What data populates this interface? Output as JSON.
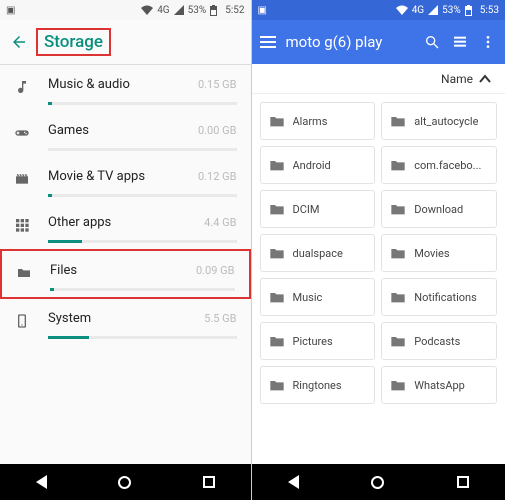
{
  "left": {
    "statusbar": {
      "lte": "4G",
      "signal": "▲",
      "battery": "53%",
      "time": "5:52"
    },
    "title": "Storage",
    "items": [
      {
        "label": "Music & audio",
        "size": "0.15 GB",
        "fill": 2,
        "icon": "music"
      },
      {
        "label": "Games",
        "size": "0.00 GB",
        "fill": 0,
        "icon": "gamepad"
      },
      {
        "label": "Movie & TV apps",
        "size": "0.12 GB",
        "fill": 2,
        "icon": "movie"
      },
      {
        "label": "Other apps",
        "size": "4.4 GB",
        "fill": 18,
        "icon": "grid"
      },
      {
        "label": "Files",
        "size": "0.09 GB",
        "fill": 2,
        "icon": "folder",
        "highlight": true
      },
      {
        "label": "System",
        "size": "5.5 GB",
        "fill": 22,
        "icon": "system"
      }
    ]
  },
  "right": {
    "statusbar": {
      "lte": "4G",
      "signal": "▲",
      "battery": "53%",
      "time": "5:53"
    },
    "title": "moto g(6) play",
    "sort_label": "Name",
    "folders": [
      "Alarms",
      "alt_autocycle",
      "Android",
      "com.facebo...",
      "DCIM",
      "Download",
      "dualspace",
      "Movies",
      "Music",
      "Notifications",
      "Pictures",
      "Podcasts",
      "Ringtones",
      "WhatsApp"
    ]
  }
}
